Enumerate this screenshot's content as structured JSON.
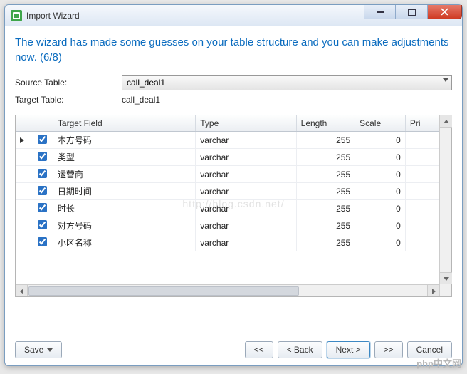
{
  "window": {
    "title": "Import Wizard"
  },
  "heading": "The wizard has made some guesses on your table structure and you can make adjustments now. (6/8)",
  "labels": {
    "source_table": "Source Table:",
    "target_table": "Target Table:"
  },
  "source_table_value": "call_deal1",
  "target_table_value": "call_deal1",
  "columns": {
    "target_field": "Target Field",
    "type": "Type",
    "length": "Length",
    "scale": "Scale",
    "primary": "Pri"
  },
  "rows": [
    {
      "checked": true,
      "current": true,
      "field": "本方号码",
      "type": "varchar",
      "length": "255",
      "scale": "0"
    },
    {
      "checked": true,
      "current": false,
      "field": "类型",
      "type": "varchar",
      "length": "255",
      "scale": "0"
    },
    {
      "checked": true,
      "current": false,
      "field": "运营商",
      "type": "varchar",
      "length": "255",
      "scale": "0"
    },
    {
      "checked": true,
      "current": false,
      "field": "日期时间",
      "type": "varchar",
      "length": "255",
      "scale": "0"
    },
    {
      "checked": true,
      "current": false,
      "field": "时长",
      "type": "varchar",
      "length": "255",
      "scale": "0"
    },
    {
      "checked": true,
      "current": false,
      "field": "对方号码",
      "type": "varchar",
      "length": "255",
      "scale": "0"
    },
    {
      "checked": true,
      "current": false,
      "field": "小区名称",
      "type": "varchar",
      "length": "255",
      "scale": "0"
    }
  ],
  "buttons": {
    "save": "Save",
    "first": "<<",
    "back": "< Back",
    "next": "Next >",
    "last": ">>",
    "cancel": "Cancel"
  },
  "watermark": "php中文网",
  "watermark_bg": "http://blog.csdn.net/"
}
